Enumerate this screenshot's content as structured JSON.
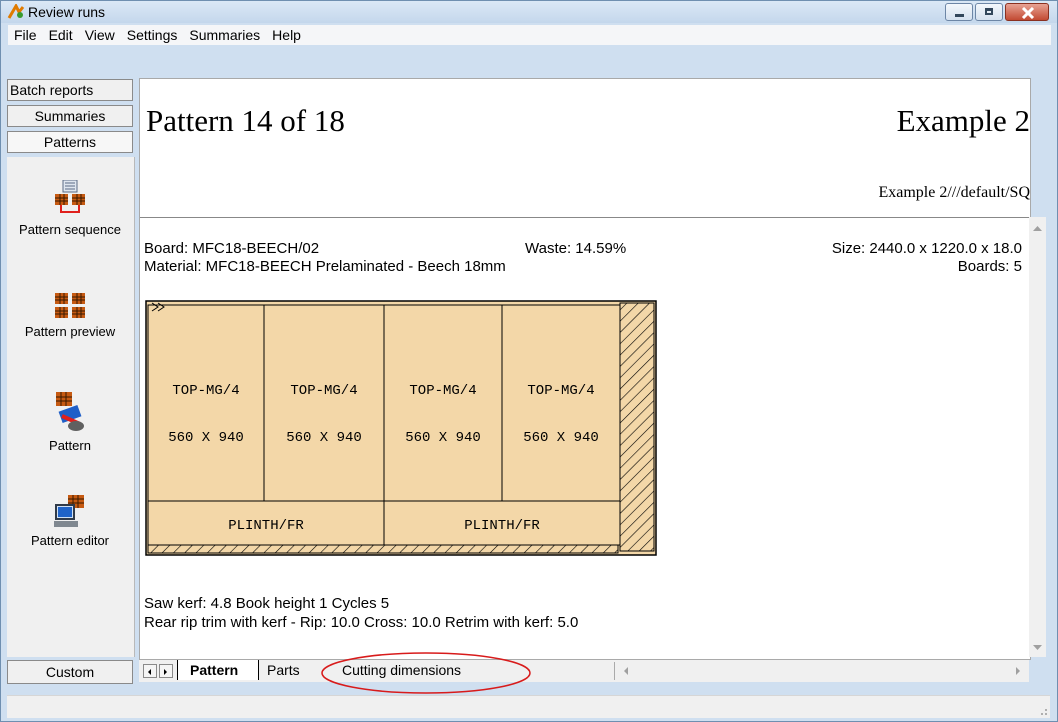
{
  "window": {
    "title": "Review runs"
  },
  "menu": [
    "File",
    "Edit",
    "View",
    "Settings",
    "Summaries",
    "Help"
  ],
  "left_tabs": [
    "Batch reports",
    "Summaries",
    "Patterns"
  ],
  "nav": [
    {
      "label": "Pattern sequence",
      "icon": "pattern-sequence-icon"
    },
    {
      "label": "Pattern preview",
      "icon": "pattern-preview-icon"
    },
    {
      "label": "Pattern",
      "icon": "pattern-icon"
    },
    {
      "label": "Pattern editor",
      "icon": "pattern-editor-icon"
    }
  ],
  "custom_button": "Custom",
  "header": {
    "pattern_title": "Pattern 14 of 18",
    "run_title": "Example 2",
    "run_path": "Example 2///default/SQ"
  },
  "info": {
    "board": "Board: MFC18-BEECH/02",
    "waste": "Waste: 14.59%",
    "size": "Size: 2440.0 x 1220.0 x  18.0",
    "material": "Material: MFC18-BEECH  Prelaminated - Beech 18mm",
    "boards": "Boards: 5"
  },
  "parts": {
    "top_label": "TOP-MG/4",
    "top_dims": "560 X 940",
    "plinth_label": "PLINTH/FR"
  },
  "footer": {
    "line1": "Saw kerf: 4.8  Book height 1  Cycles 5",
    "line2": "Rear rip trim with kerf - Rip: 10.0 Cross: 10.0 Retrim with kerf: 5.0"
  },
  "tabs": [
    "Pattern",
    "Parts",
    "Cutting dimensions"
  ],
  "colors": {
    "wood": "#f3d7a8",
    "highlight": "#d81b1b"
  }
}
